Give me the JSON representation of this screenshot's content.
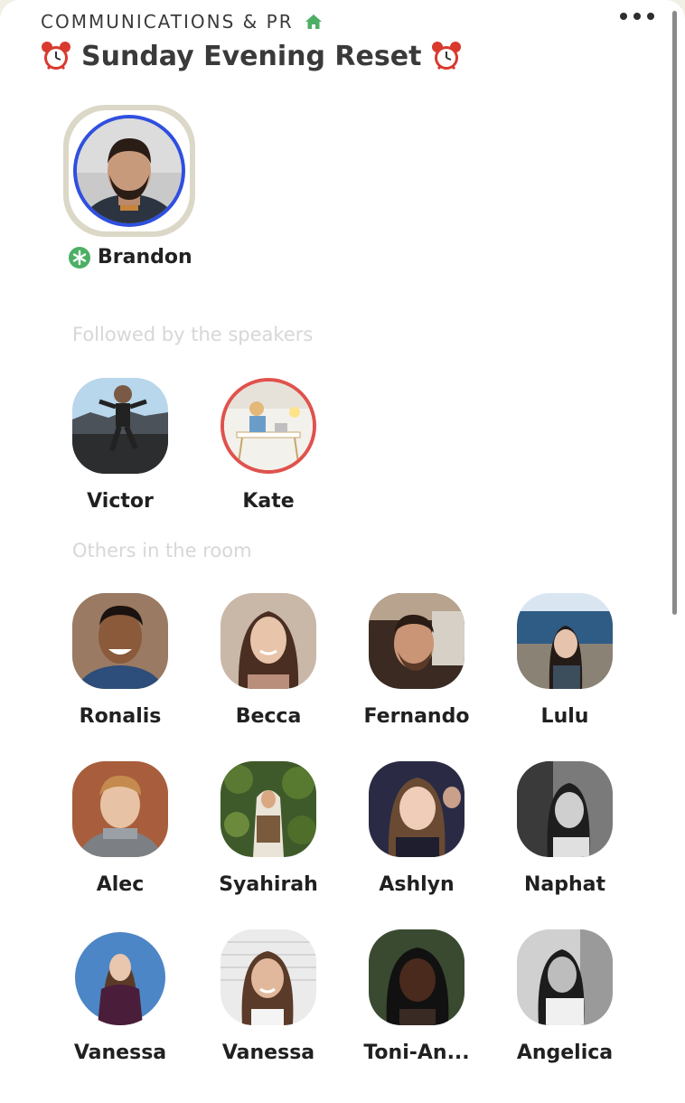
{
  "header": {
    "club_name": "COMMUNICATIONS & PR",
    "house_icon": "house-icon",
    "more_icon": "more-dots-icon",
    "room_title": "Sunday Evening Reset",
    "title_emoji": "alarm-clock-icon"
  },
  "speakers": [
    {
      "name": "Brandon",
      "badge": "moderator-star-icon",
      "ring_color": "#2f4fe0"
    }
  ],
  "sections": {
    "followed": "Followed by the speakers",
    "others": "Others in the room"
  },
  "followed_by_speakers": [
    {
      "name": "Victor"
    },
    {
      "name": "Kate"
    }
  ],
  "others": [
    {
      "name": "Ronalis"
    },
    {
      "name": "Becca"
    },
    {
      "name": "Fernando"
    },
    {
      "name": "Lulu"
    },
    {
      "name": "Alec"
    },
    {
      "name": "Syahirah"
    },
    {
      "name": "Ashlyn"
    },
    {
      "name": "Naphat"
    },
    {
      "name": "Vanessa"
    },
    {
      "name": "Vanessa"
    },
    {
      "name": "Toni-An..."
    },
    {
      "name": "Angelica"
    }
  ],
  "colors": {
    "background": "#ffffff",
    "outer": "#f2efe4",
    "accent_green": "#4caf64",
    "speaker_ring": "#2f4fe0",
    "new_user_ring": "#e0524d"
  }
}
